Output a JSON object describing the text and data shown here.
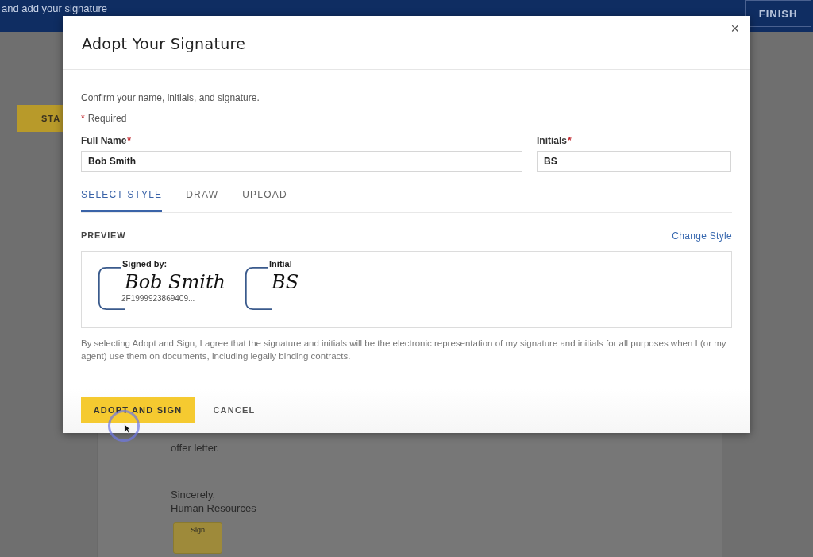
{
  "top_bar": {
    "instruction": "and add your signature",
    "finish_button": "FINISH"
  },
  "background": {
    "start_button": "STA",
    "letter_lines": [
      "offer letter.",
      "Sincerely,",
      "Human Resources"
    ],
    "sign_button": "Sign"
  },
  "dialog": {
    "title": "Adopt Your Signature",
    "close": "×",
    "intro": "Confirm your name, initials, and signature.",
    "required_mark": "*",
    "required_note": "Required",
    "fields": [
      {
        "label": "Full Name",
        "required": true,
        "value": "Bob Smith"
      },
      {
        "label": "Initials",
        "required": true,
        "value": "BS"
      }
    ],
    "tabs": [
      {
        "label": "SELECT STYLE",
        "selected": true
      },
      {
        "label": "DRAW",
        "selected": false
      },
      {
        "label": "UPLOAD",
        "selected": false
      }
    ],
    "preview_label": "PREVIEW",
    "change_style": "Change Style",
    "signature": {
      "caption": "Signed by:",
      "text": "Bob Smith",
      "id": "2F1999923869409..."
    },
    "initials": {
      "caption": "Initial",
      "text": "BS"
    },
    "disclaimer": "By selecting Adopt and Sign, I agree that the signature and initials will be the electronic representation of my signature and initials for all purposes when I (or my agent) use them on documents, including legally binding contracts.",
    "buttons": [
      {
        "label": "ADOPT AND SIGN",
        "kind": "primary"
      },
      {
        "label": "CANCEL",
        "kind": "plain"
      }
    ]
  }
}
